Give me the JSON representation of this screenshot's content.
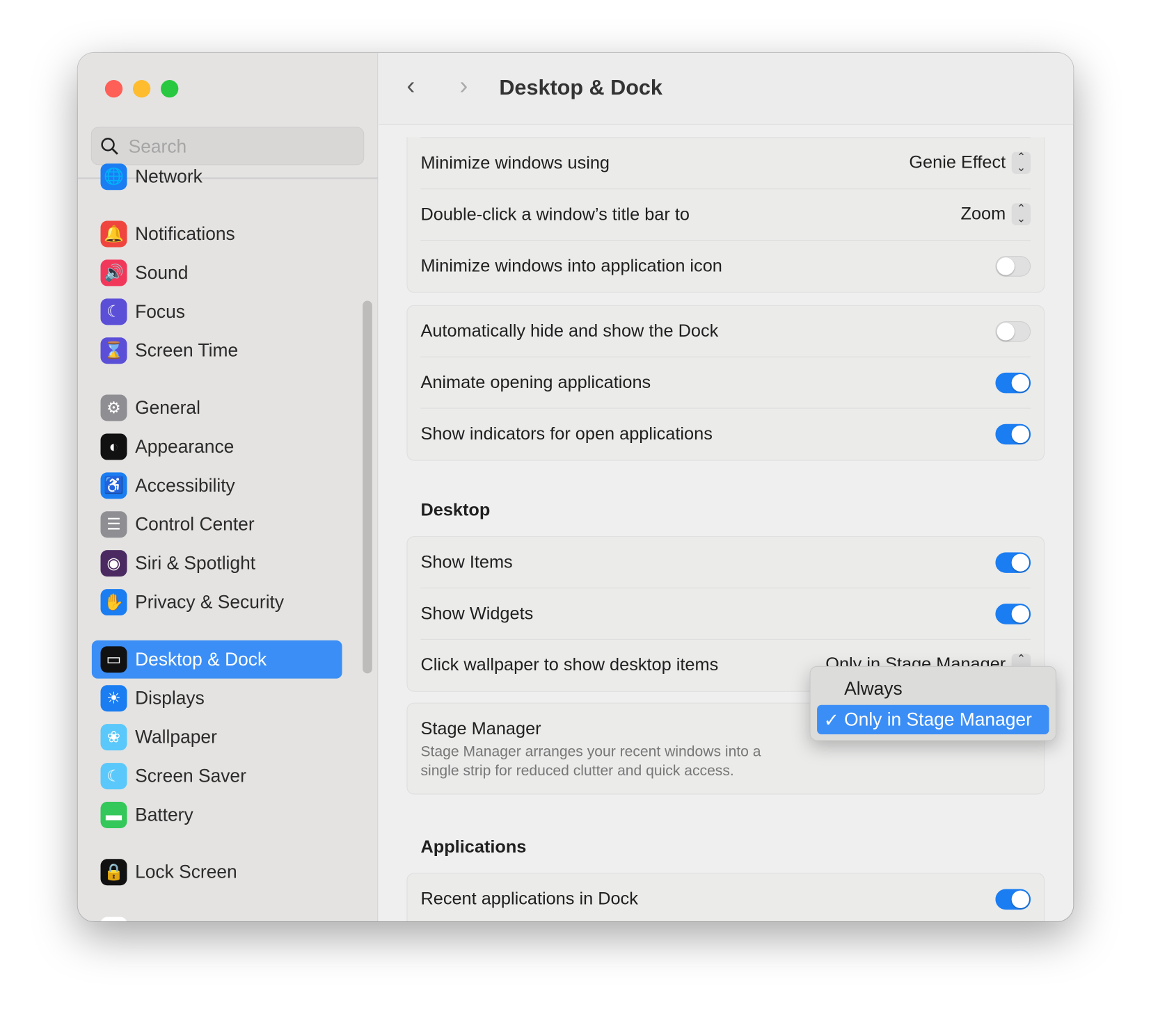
{
  "window": {
    "title": "Desktop & Dock"
  },
  "search": {
    "placeholder": "Search"
  },
  "sidebar": {
    "items": [
      {
        "label": "Network",
        "icon": "globe-icon",
        "color": "#1a7df2",
        "glyph": "🌐"
      },
      {
        "label": "Notifications",
        "icon": "bell-icon",
        "color": "#f0453e",
        "glyph": "🔔"
      },
      {
        "label": "Sound",
        "icon": "speaker-icon",
        "color": "#f2385a",
        "glyph": "🔊"
      },
      {
        "label": "Focus",
        "icon": "moon-icon",
        "color": "#5b4fd8",
        "glyph": "☾"
      },
      {
        "label": "Screen Time",
        "icon": "hourglass-icon",
        "color": "#5b4fd8",
        "glyph": "⌛"
      },
      {
        "label": "General",
        "icon": "gear-icon",
        "color": "#8e8e93",
        "glyph": "⚙"
      },
      {
        "label": "Appearance",
        "icon": "appearance-icon",
        "color": "#111111",
        "glyph": "◐"
      },
      {
        "label": "Accessibility",
        "icon": "accessibility-icon",
        "color": "#1a7df2",
        "glyph": "♿"
      },
      {
        "label": "Control Center",
        "icon": "switches-icon",
        "color": "#8e8e93",
        "glyph": "☰"
      },
      {
        "label": "Siri & Spotlight",
        "icon": "siri-icon",
        "color": "#4a2a60",
        "glyph": "◉"
      },
      {
        "label": "Privacy & Security",
        "icon": "hand-icon",
        "color": "#1a7df2",
        "glyph": "✋"
      },
      {
        "label": "Desktop & Dock",
        "icon": "dock-icon",
        "color": "#111111",
        "glyph": "▭",
        "selected": true
      },
      {
        "label": "Displays",
        "icon": "sun-icon",
        "color": "#1a7df2",
        "glyph": "☀"
      },
      {
        "label": "Wallpaper",
        "icon": "flower-icon",
        "color": "#5ac8fa",
        "glyph": "❀"
      },
      {
        "label": "Screen Saver",
        "icon": "screensaver-icon",
        "color": "#5ac8fa",
        "glyph": "☾"
      },
      {
        "label": "Battery",
        "icon": "battery-icon",
        "color": "#34c759",
        "glyph": "▬"
      },
      {
        "label": "Lock Screen",
        "icon": "lock-icon",
        "color": "#111111",
        "glyph": "🔒"
      }
    ]
  },
  "groups": [
    {
      "rows": [
        {
          "label": "Minimize windows using",
          "type": "popup",
          "value": "Genie Effect"
        },
        {
          "label": "Double-click a window’s title bar to",
          "type": "popup",
          "value": "Zoom"
        },
        {
          "label": "Minimize windows into application icon",
          "type": "toggle",
          "on": false
        }
      ]
    },
    {
      "rows": [
        {
          "label": "Automatically hide and show the Dock",
          "type": "toggle",
          "on": false
        },
        {
          "label": "Animate opening applications",
          "type": "toggle",
          "on": true
        },
        {
          "label": "Show indicators for open applications",
          "type": "toggle",
          "on": true
        }
      ]
    }
  ],
  "desktop": {
    "heading": "Desktop",
    "rows": [
      {
        "label": "Show Items",
        "on": true
      },
      {
        "label": "Show Widgets",
        "on": true
      }
    ],
    "click_wallpaper": {
      "label": "Click wallpaper to show desktop items",
      "value": "Only in Stage Manager"
    }
  },
  "stage_manager": {
    "title": "Stage Manager",
    "description_line1": "Stage Manager arranges your recent windows into a",
    "description_line2": "single strip for reduced clutter and quick access."
  },
  "dropdown": {
    "options": [
      "Always",
      "Only in Stage Manager"
    ],
    "selected": "Only in Stage Manager",
    "check": "✓"
  },
  "applications": {
    "heading": "Applications",
    "rows": [
      {
        "label": "Recent applications in Dock",
        "on": true
      }
    ]
  },
  "colors": {
    "accent": "#3b8ef5",
    "toggle_on": "#1a7df2"
  }
}
